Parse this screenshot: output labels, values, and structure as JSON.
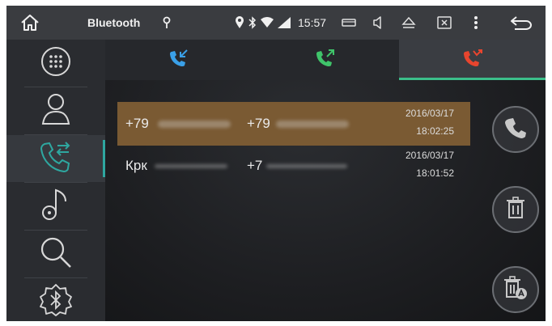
{
  "statusbar": {
    "title": "Bluetooth",
    "time": "15:57",
    "icons": [
      "home-icon",
      "location-pin-icon",
      "location-icon",
      "bluetooth-icon",
      "wifi-icon",
      "signal-icon",
      "window-icon",
      "volume-icon",
      "eject-icon",
      "close-box-icon",
      "more-vertical-icon",
      "back-icon"
    ]
  },
  "sidebar": {
    "items": [
      {
        "icon": "dialpad-icon",
        "active": false
      },
      {
        "icon": "contacts-icon",
        "active": false
      },
      {
        "icon": "call-log-icon",
        "active": true
      },
      {
        "icon": "music-icon",
        "active": false
      },
      {
        "icon": "search-icon",
        "active": false
      },
      {
        "icon": "bluetooth-settings-icon",
        "active": false
      }
    ]
  },
  "tabs": [
    {
      "icon": "incoming-call-icon",
      "color": "#3aa0e8",
      "active": false
    },
    {
      "icon": "outgoing-call-icon",
      "color": "#3fc46a",
      "active": false
    },
    {
      "icon": "missed-call-icon",
      "color": "#e8452e",
      "active": true
    }
  ],
  "calls": [
    {
      "name": "+79",
      "number": "+79",
      "date": "2016/03/17",
      "time": "18:02:25",
      "selected": true
    },
    {
      "name": "Крк",
      "number": "+7",
      "date": "2016/03/17",
      "time": "18:01:52",
      "selected": false
    }
  ],
  "actions": [
    "call-button",
    "delete-button",
    "delete-all-button"
  ],
  "colors": {
    "accent": "#3bbf8a",
    "selected_row": "#7a5a33",
    "statusbar": "#3a3c40"
  }
}
